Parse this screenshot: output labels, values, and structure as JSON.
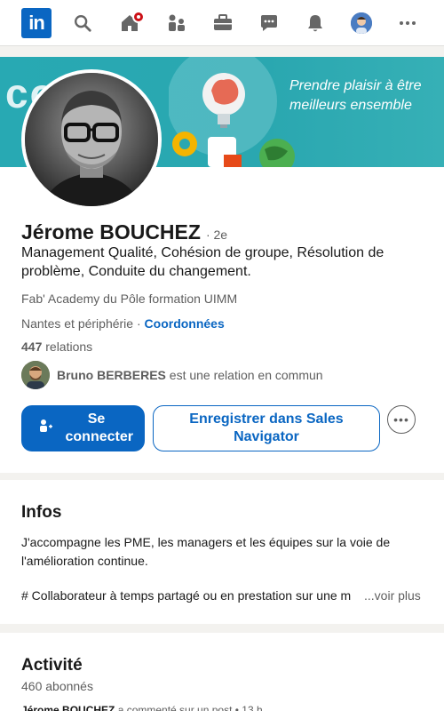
{
  "nav": {
    "logo_text": "in",
    "icons": [
      "search-icon",
      "home-icon",
      "my-network-icon",
      "jobs-icon",
      "messaging-icon",
      "notifications-icon",
      "me-avatar",
      "more-icon"
    ]
  },
  "banner": {
    "word": "co...o",
    "tagline": "Prendre plaisir à être meilleurs ensemble"
  },
  "profile": {
    "name": "Jérome BOUCHEZ",
    "degree": "· 2e",
    "headline": "Management Qualité, Cohésion de groupe, Résolution de problème, Conduite du changement.",
    "company": "Fab' Academy du Pôle formation UIMM",
    "location": "Nantes et périphérie",
    "location_sep": " · ",
    "contact_link": "Coordonnées",
    "relations_count": "447",
    "relations_label": " relations",
    "mutual_name": "Bruno BERBERES",
    "mutual_text": " est une relation en commun",
    "connect_label": "Se connecter",
    "sales_label": "Enregistrer dans Sales Navigator",
    "more_label": "•••"
  },
  "infos": {
    "title": "Infos",
    "text": "J'accompagne les PME, les managers et les équipes sur la voie de l'amélioration continue.",
    "line3": "# Collaborateur à temps partagé ou en prestation sur une m",
    "more": "...voir plus"
  },
  "activity": {
    "title": "Activité",
    "followers": "460 abonnés",
    "post_author": "Jérome BOUCHEZ",
    "post_text": " a commenté sur un post • 13 h"
  },
  "colors": {
    "brand": "#0a66c2",
    "banner": "#28a9b3",
    "notification": "#cc1016"
  }
}
